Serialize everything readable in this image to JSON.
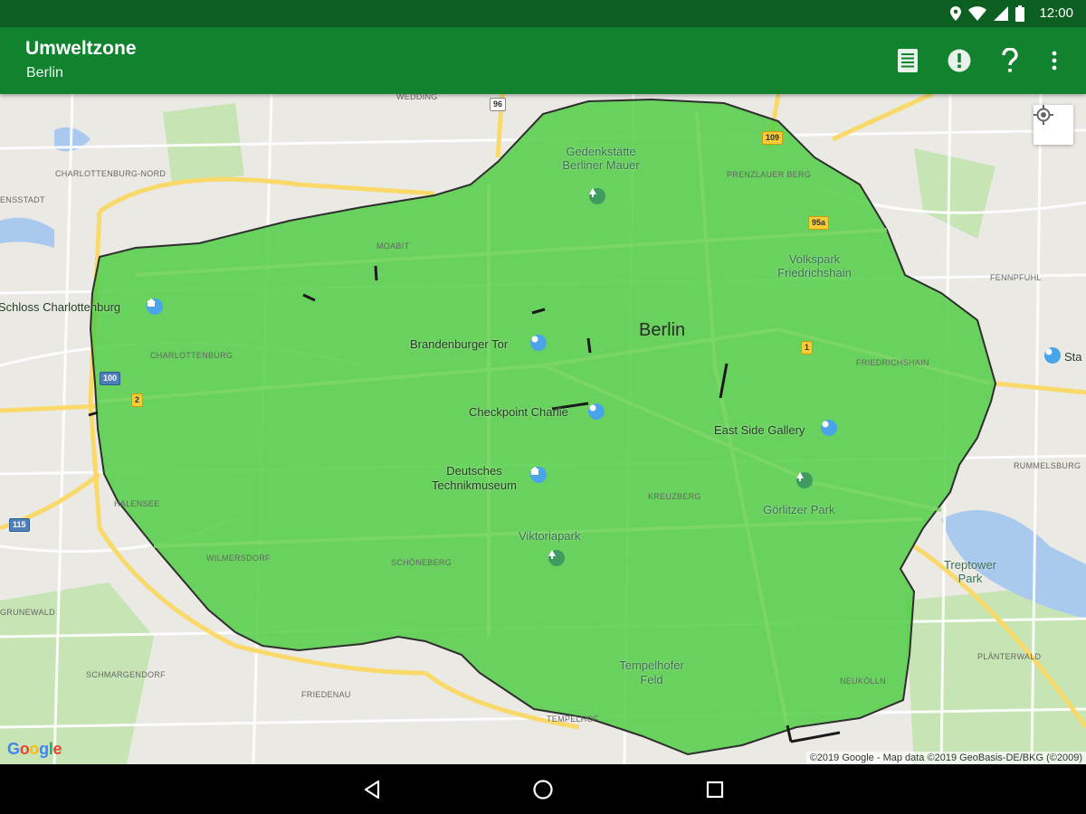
{
  "status_bar": {
    "time": "12:00",
    "icons": [
      "location-icon",
      "wifi-icon",
      "signal-icon",
      "battery-icon"
    ]
  },
  "app_bar": {
    "title": "Umweltzone",
    "subtitle": "Berlin",
    "actions": [
      "list-icon",
      "alert-icon",
      "help-icon",
      "overflow-menu-icon"
    ]
  },
  "map": {
    "city_label": "Berlin",
    "zone_color": "#4ccc3f",
    "district_labels": [
      "Wedding",
      "Charlottenburg-Nord",
      "Ensstadt",
      "Moabit",
      "Charlottenburg",
      "Prenzlauer Berg",
      "Fennpfuhl",
      "Friedrichshain",
      "Rummelsburg",
      "Halensee",
      "Kreuzberg",
      "Wilmersdorf",
      "Schöneberg",
      "Schmargendorf",
      "Friedenau",
      "Tempelhof",
      "Neukölln",
      "Plänterwald",
      "Grunewald"
    ],
    "places": [
      "Gedenkstätte Berliner Mauer",
      "Volkspark Friedrichshain",
      "Schloss Charlottenburg",
      "Brandenburger Tor",
      "Checkpoint Charlie",
      "East Side Gallery",
      "Deutsches Technikmuseum",
      "Görlitzer Park",
      "Viktoriapark",
      "Treptower Park",
      "Tempelhofer Feld",
      "Sta"
    ],
    "shields": [
      "96",
      "109",
      "95a",
      "1",
      "2",
      "100",
      "115"
    ],
    "google_logo": "Google",
    "attribution": "©2019 Google - Map data ©2019 GeoBasis-DE/BKG (©2009)"
  },
  "nav_bar": {
    "buttons": [
      "back-icon",
      "home-icon",
      "recents-icon"
    ]
  }
}
